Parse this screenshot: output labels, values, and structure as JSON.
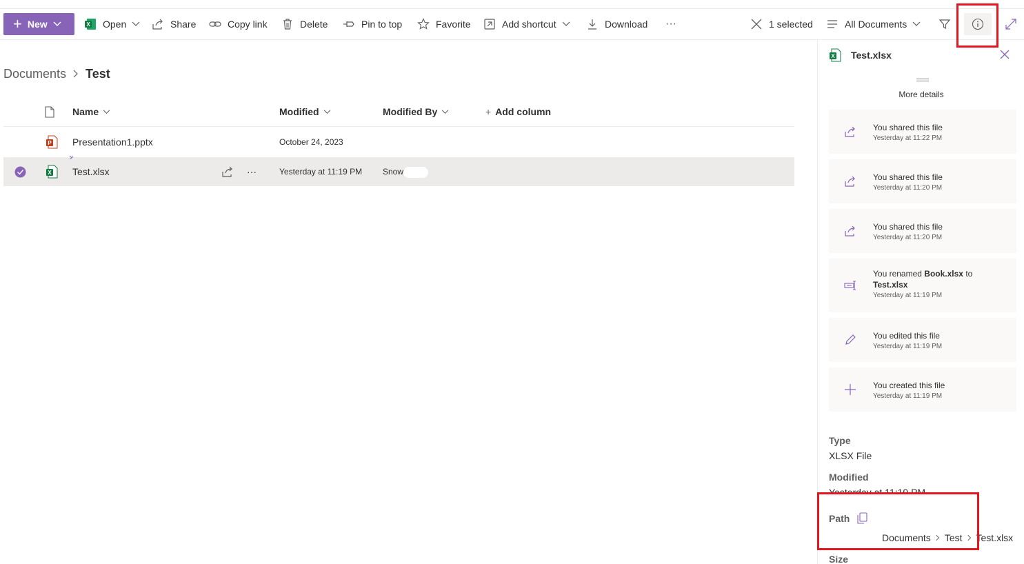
{
  "toolbar": {
    "new_label": "New",
    "open_label": "Open",
    "share_label": "Share",
    "copy_link_label": "Copy link",
    "delete_label": "Delete",
    "pin_label": "Pin to top",
    "favorite_label": "Favorite",
    "add_shortcut_label": "Add shortcut",
    "download_label": "Download",
    "more_label": "···",
    "selected_label": "1 selected",
    "view_label": "All Documents"
  },
  "breadcrumb": {
    "root": "Documents",
    "current": "Test"
  },
  "list": {
    "columns": {
      "name": "Name",
      "modified": "Modified",
      "modified_by": "Modified By",
      "add_column": "Add column"
    },
    "rows": [
      {
        "name": "Presentation1.pptx",
        "modified": "October 24, 2023",
        "modified_by": "",
        "type": "pptx",
        "selected": false
      },
      {
        "name": "Test.xlsx",
        "modified": "Yesterday at 11:19 PM",
        "modified_by": "Snow",
        "type": "xlsx",
        "selected": true
      }
    ],
    "more_label": "···"
  },
  "details": {
    "title": "Test.xlsx",
    "more_details": "More details",
    "activities": [
      {
        "icon": "share-icon",
        "text": "You shared this file",
        "time": "Yesterday at 11:22 PM"
      },
      {
        "icon": "share-icon",
        "text": "You shared this file",
        "time": "Yesterday at 11:20 PM"
      },
      {
        "icon": "share-icon",
        "text": "You shared this file",
        "time": "Yesterday at 11:20 PM"
      },
      {
        "icon": "rename-icon",
        "text_prefix": "You renamed ",
        "old_name": "Book.xlsx",
        "text_mid": " to ",
        "new_name": "Test.xlsx",
        "time": "Yesterday at 11:19 PM"
      },
      {
        "icon": "edit-icon",
        "text": "You edited this file",
        "time": "Yesterday at 11:19 PM"
      },
      {
        "icon": "add-icon",
        "text": "You created this file",
        "time": "Yesterday at 11:19 PM"
      }
    ],
    "type_label": "Type",
    "type_value": "XLSX File",
    "modified_label": "Modified",
    "modified_value": "Yesterday at 11:19 PM",
    "path_label": "Path",
    "path": [
      "Documents",
      "Test",
      "Test.xlsx"
    ],
    "size_label": "Size"
  },
  "colors": {
    "accent": "#8764b8",
    "highlight": "#e3161f",
    "excel": "#107c41",
    "powerpoint": "#c43e1c"
  }
}
